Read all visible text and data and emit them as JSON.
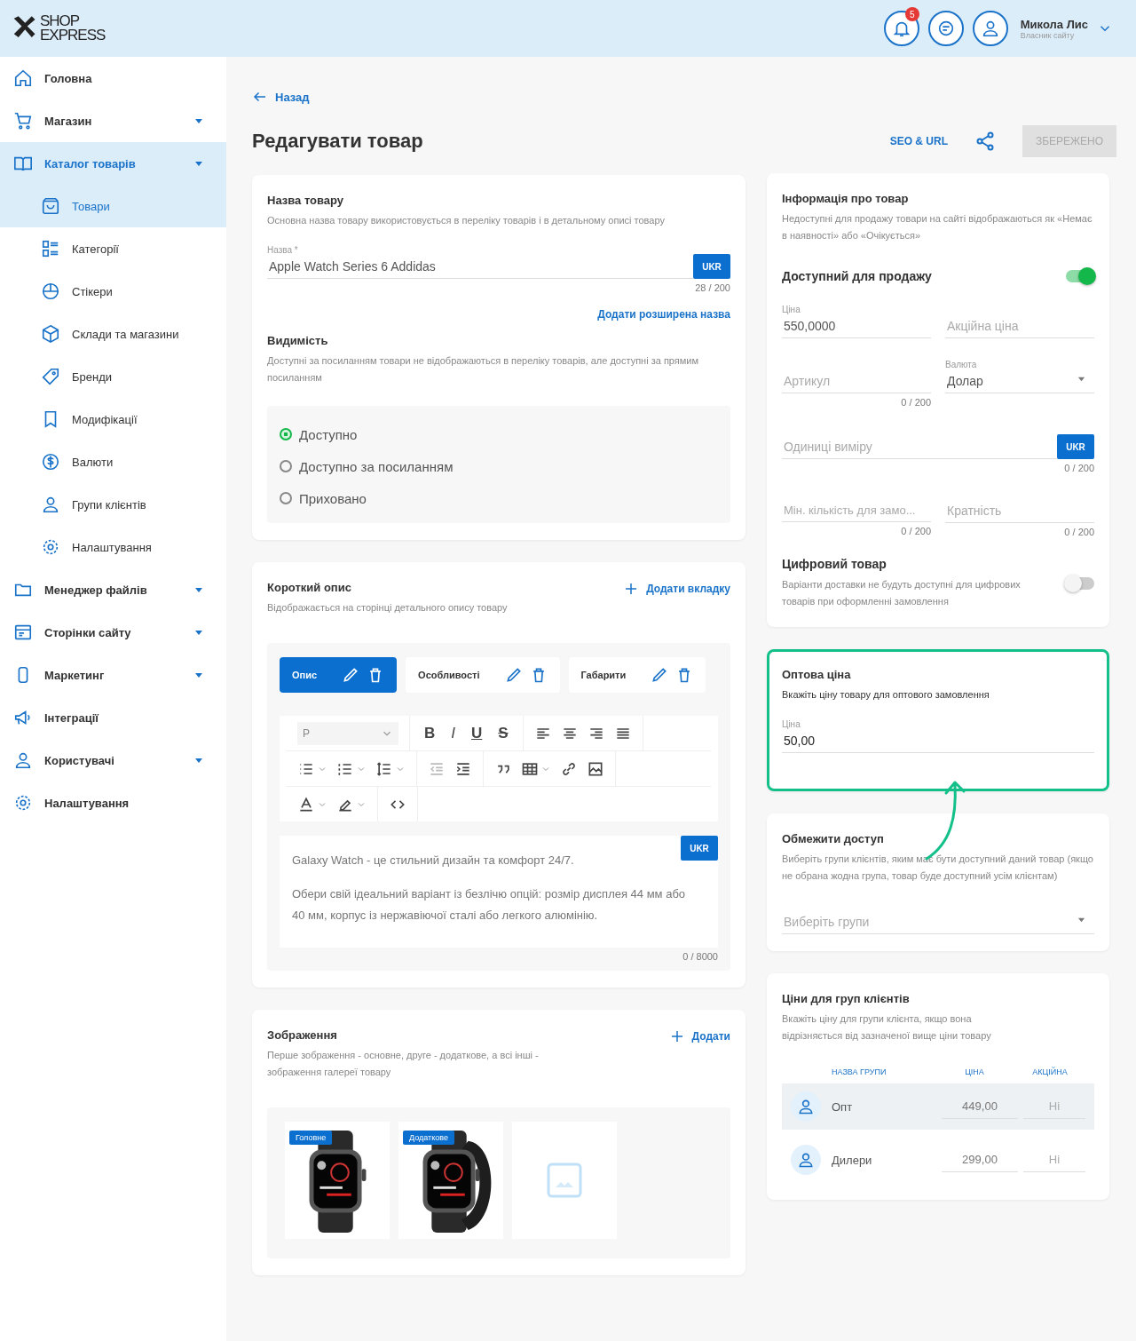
{
  "header": {
    "logo_top": "SHOP",
    "logo_bottom": "EXPRESS",
    "notifications": "5",
    "user_name": "Микола Лис",
    "user_role": "Власник сайту"
  },
  "sidebar": {
    "items": [
      {
        "label": "Головна",
        "caret": false,
        "selected": false
      },
      {
        "label": "Магазин",
        "caret": true,
        "selected": false
      },
      {
        "label": "Каталог товарів",
        "caret": true,
        "selected": true,
        "children": [
          {
            "label": "Товари",
            "selected": true
          },
          {
            "label": "Категорії",
            "selected": false
          },
          {
            "label": "Стікери",
            "selected": false
          },
          {
            "label": "Склади та магазини",
            "selected": false
          },
          {
            "label": "Бренди",
            "selected": false
          },
          {
            "label": "Модифікації",
            "selected": false
          },
          {
            "label": "Валюти",
            "selected": false
          },
          {
            "label": "Групи клієнтів",
            "selected": false
          },
          {
            "label": "Налаштування",
            "selected": false
          }
        ]
      },
      {
        "label": "Менеджер файлів",
        "caret": true,
        "selected": false
      },
      {
        "label": "Сторінки сайту",
        "caret": true,
        "selected": false
      },
      {
        "label": "Маркетинг",
        "caret": true,
        "selected": false
      },
      {
        "label": "Інтеграції",
        "caret": false,
        "selected": false
      },
      {
        "label": "Користувачі",
        "caret": true,
        "selected": false
      },
      {
        "label": "Налаштування",
        "caret": false,
        "selected": false
      }
    ]
  },
  "back": "Назад",
  "title": "Редагувати товар",
  "actions": {
    "seo": "SEO & URL",
    "save": "ЗБЕРЕЖЕНО",
    "save_disabled": true
  },
  "name_card": {
    "title": "Назва товару",
    "desc": "Основна назва товару використовується в переліку товарів і в детальному описі товару",
    "label": "Назва *",
    "value": "Apple Watch Series 6 Addidas",
    "lang": "UKR",
    "counter": "28 / 200",
    "link": "Додати розширена назва"
  },
  "visibility": {
    "title": "Видимість",
    "desc": "Доступні за посиланням товари не відображаються в переліку товарів, але доступні за прямим посиланням",
    "options": [
      {
        "label": "Доступно",
        "selected": true
      },
      {
        "label": "Доступно за посиланням",
        "selected": false
      },
      {
        "label": "Приховано",
        "selected": false
      }
    ]
  },
  "short_desc": {
    "title": "Короткий опис",
    "desc": "Відображається на сторінці детального опису товару",
    "add_tab": "Додати вкладку",
    "tabs": [
      {
        "label": "Опис",
        "selected": true
      },
      {
        "label": "Особливості",
        "selected": false
      },
      {
        "label": "Габарити",
        "selected": false
      }
    ],
    "format": "P",
    "styles": [
      "B",
      "I",
      "U",
      "S"
    ],
    "lang": "UKR",
    "paragraphs": [
      "Galaxy Watch - це стильний дизайн та комфорт 24/7.",
      "Обери свій ідеальний варіант із безлічю опцій: розмір дисплея 44 мм або 40 мм, корпус із нержавіючої сталі або легкого алюмінію."
    ],
    "counter": "0 / 8000"
  },
  "images": {
    "title": "Зображення",
    "desc": "Перше зображення - основне, друге - додаткове, а всі інші - зображення галереї товару",
    "add": "Додати",
    "items": [
      {
        "kind": "picture",
        "badge": "Головне"
      },
      {
        "kind": "picture",
        "badge": "Додаткове"
      },
      {
        "kind": "empty"
      }
    ]
  },
  "info": {
    "title": "Інформація про товар",
    "desc": "Недоступні для продажу товари на сайті відображаються як «Немає в наявності» або «Очікується»",
    "available_label": "Доступний для продажу",
    "available": true,
    "price_label": "Ціна",
    "price": "550,0000",
    "sale_placeholder": "Акційна ціна",
    "sku_placeholder": "Артикул",
    "sku_counter": "0 / 200",
    "currency_label": "Валюта",
    "currency": "Долар",
    "unit_placeholder": "Одиниці виміру",
    "unit_lang": "UKR",
    "unit_counter": "0 / 200",
    "min_placeholder": "Мін. кількість для замо...",
    "min_counter": "0 / 200",
    "mult_placeholder": "Кратність",
    "mult_counter": "0 / 200",
    "digital_label": "Цифровий товар",
    "digital_desc": "Варіанти доставки не будуть доступні для цифрових товарів при оформленні замовлення",
    "digital": false
  },
  "wholesale": {
    "title": "Оптова ціна",
    "desc": "Вкажіть ціну товару для оптового замовлення",
    "label": "Ціна",
    "value": "50,00",
    "highlighted": true
  },
  "access": {
    "title": "Обмежити доступ",
    "desc": "Виберіть групи клієнтів, яким має бути доступний даний товар (якщо не обрана жодна група, товар буде доступний усім клієнтам)",
    "placeholder": "Виберіть групи"
  },
  "group_prices": {
    "title": "Ціни для груп клієнтів",
    "desc": "Вкажіть ціну для групи клієнта, якщо вона відрізняється від зазначеної вище ціни товару",
    "columns": [
      "НАЗВА ГРУПИ",
      "ЦІНА",
      "АКЦІЙНА"
    ],
    "rows": [
      {
        "name": "Опт",
        "price": "449,00",
        "sale": "Ні",
        "selected": true
      },
      {
        "name": "Дилери",
        "price": "299,00",
        "sale": "Ні",
        "selected": false
      }
    ]
  }
}
